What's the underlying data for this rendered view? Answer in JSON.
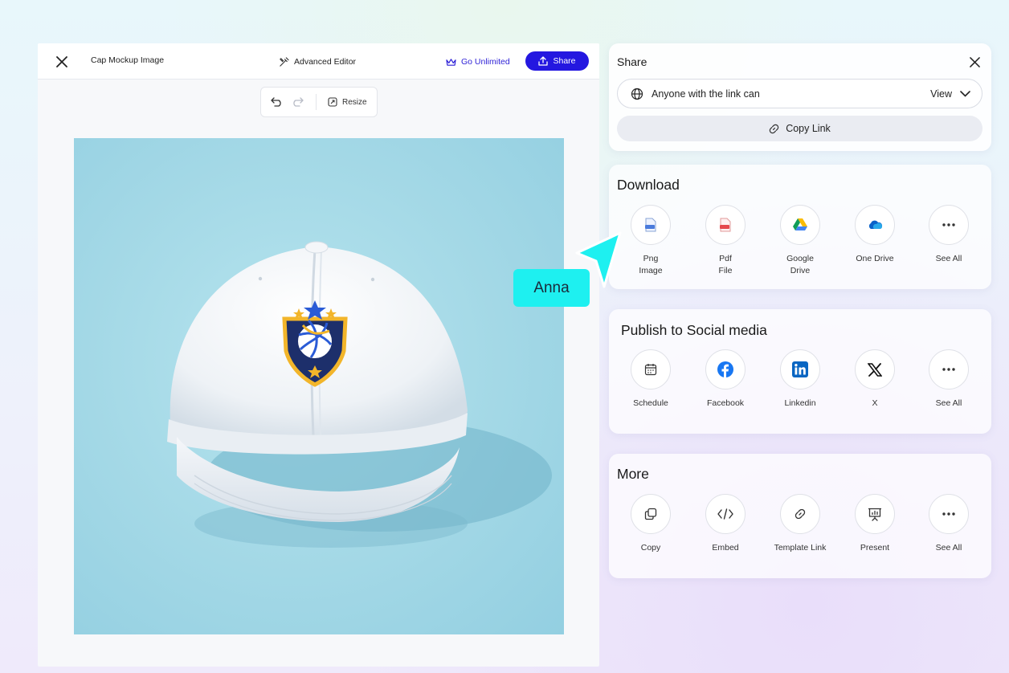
{
  "editor": {
    "title": "Cap Mockup Image",
    "advanced_editor_label": "Advanced Editor",
    "go_unlimited_label": "Go Unlimited",
    "share_label": "Share",
    "resize_label": "Resize"
  },
  "share_panel": {
    "title": "Share",
    "access_text": "Anyone with the link can",
    "access_value": "View",
    "copy_link_label": "Copy Link"
  },
  "download": {
    "title": "Download",
    "items": [
      {
        "line1": "Png",
        "line2": "Image",
        "icon": "png-file-icon"
      },
      {
        "line1": "Pdf",
        "line2": "File",
        "icon": "pdf-file-icon"
      },
      {
        "line1": "Google",
        "line2": "Drive",
        "icon": "google-drive-icon"
      },
      {
        "line1": "One Drive",
        "line2": "",
        "icon": "onedrive-icon"
      },
      {
        "line1": "See All",
        "line2": "",
        "icon": "more-dots-icon"
      }
    ]
  },
  "social": {
    "title": "Publish to Social media",
    "items": [
      {
        "label": "Schedule",
        "icon": "calendar-icon"
      },
      {
        "label": "Facebook",
        "icon": "facebook-icon"
      },
      {
        "label": "Linkedin",
        "icon": "linkedin-icon"
      },
      {
        "label": "X",
        "icon": "x-logo-icon"
      },
      {
        "label": "See All",
        "icon": "more-dots-icon"
      }
    ]
  },
  "more": {
    "title": "More",
    "items": [
      {
        "label": "Copy",
        "icon": "copy-icon"
      },
      {
        "label": "Embed",
        "icon": "code-icon"
      },
      {
        "label": "Template Link",
        "icon": "link-icon"
      },
      {
        "label": "Present",
        "icon": "presentation-icon"
      },
      {
        "label": "See All",
        "icon": "more-dots-icon"
      }
    ]
  },
  "collaborator": {
    "name": "Anna",
    "color": "#1ef0f0"
  },
  "colors": {
    "primary": "#2417e0",
    "canvas_bg": "#a3d8e6"
  }
}
